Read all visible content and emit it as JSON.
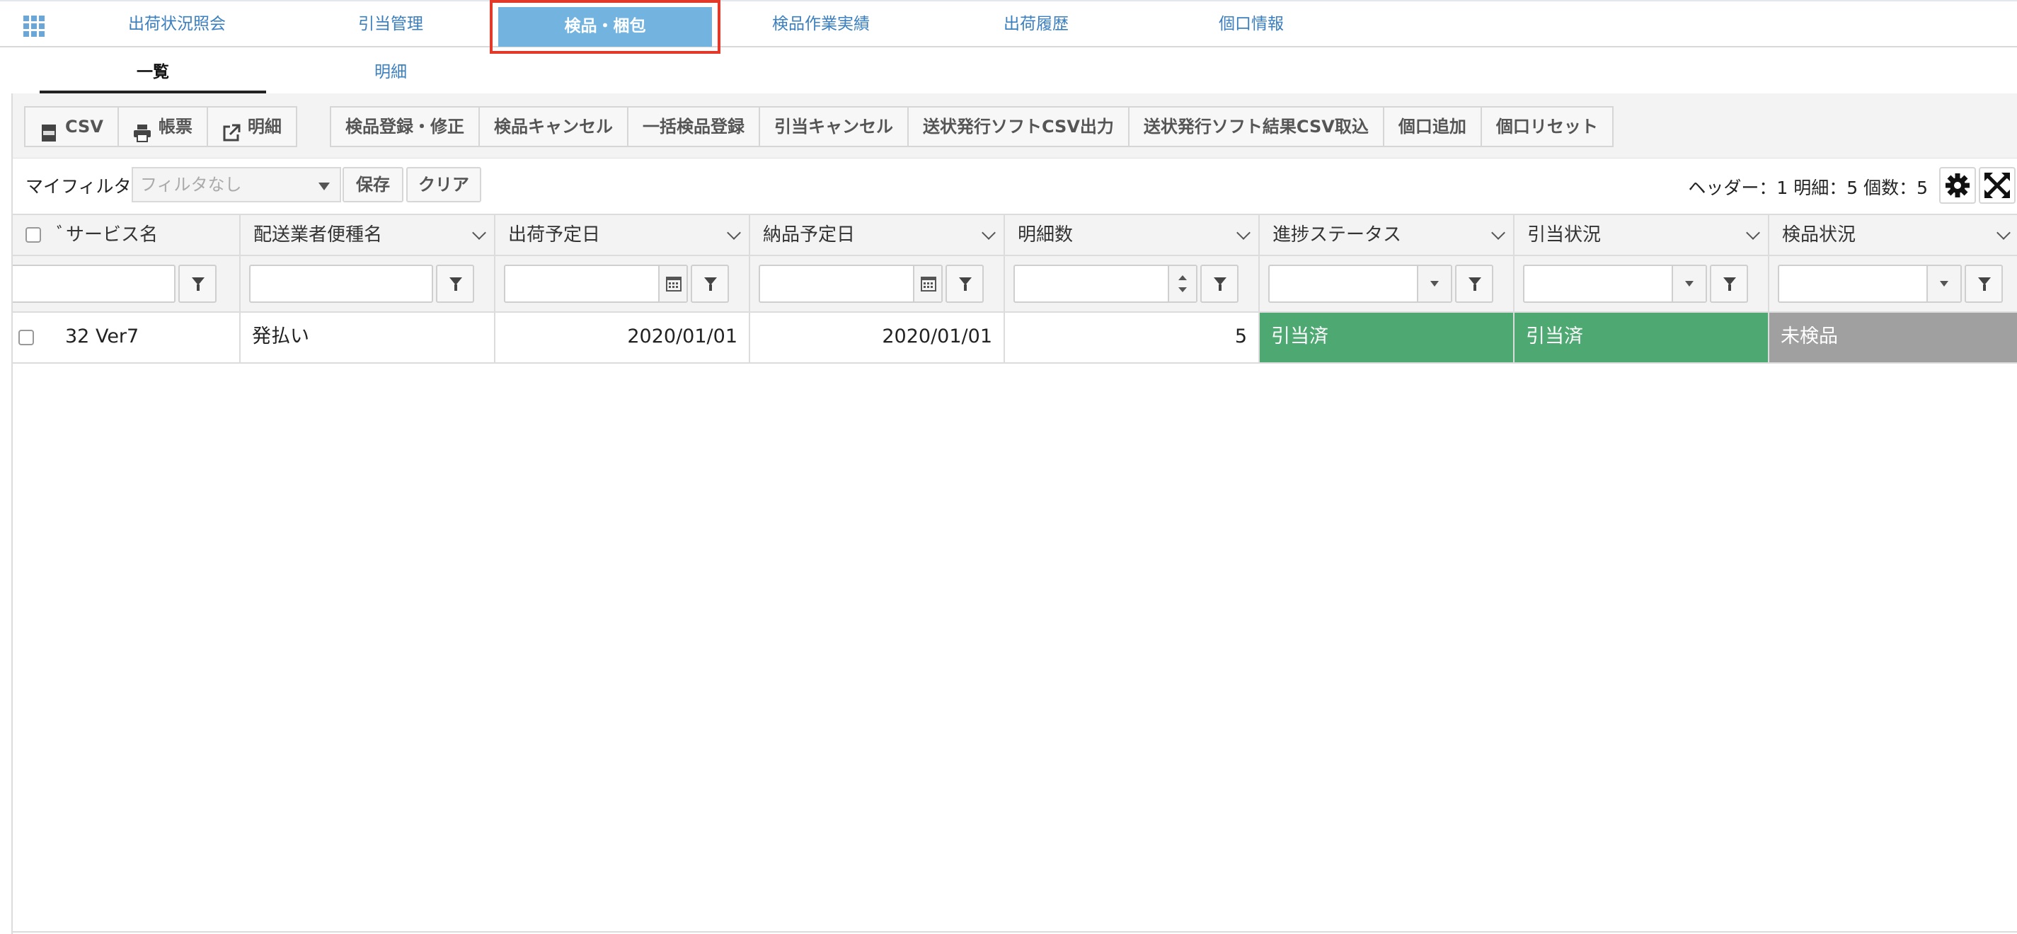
{
  "topnav": {
    "tabs": [
      {
        "label": "出荷状況照会"
      },
      {
        "label": "引当管理"
      },
      {
        "label": "検品・梱包"
      },
      {
        "label": "検品作業実績"
      },
      {
        "label": "出荷履歴"
      },
      {
        "label": "個口情報"
      }
    ],
    "active_index": 2
  },
  "subtabs": [
    {
      "label": "一覧"
    },
    {
      "label": "明細"
    }
  ],
  "toolbar": {
    "group1": [
      {
        "label": "CSV",
        "icon": "csv-icon"
      },
      {
        "label": "帳票",
        "icon": "printer-icon"
      },
      {
        "label": "明細",
        "icon": "external-link-icon"
      }
    ],
    "group2": [
      {
        "label": "検品登録・修正"
      },
      {
        "label": "検品キャンセル"
      },
      {
        "label": "一括検品登録"
      },
      {
        "label": "引当キャンセル"
      },
      {
        "label": "送状発行ソフトCSV出力"
      },
      {
        "label": "送状発行ソフト結果CSV取込"
      },
      {
        "label": "個口追加"
      },
      {
        "label": "個口リセット"
      }
    ]
  },
  "filter": {
    "label": "マイフィルタ",
    "select_value": "フィルタなし",
    "save_label": "保存",
    "clear_label": "クリア",
    "counts": "ヘッダー：1 明細：5 個数：5"
  },
  "grid": {
    "columns": [
      {
        "label": "サービス名",
        "prefix": "ﾞ"
      },
      {
        "label": "配送業者便種名"
      },
      {
        "label": "出荷予定日"
      },
      {
        "label": "納品予定日"
      },
      {
        "label": "明細数"
      },
      {
        "label": "進捗ステータス"
      },
      {
        "label": "引当状況"
      },
      {
        "label": "検品状況"
      }
    ],
    "rows": [
      {
        "service": "32 Ver7",
        "carrier": "発払い",
        "ship_date": "2020/01/01",
        "delivery_date": "2020/01/01",
        "line_count": "5",
        "progress": "引当済",
        "allocation": "引当済",
        "inspection": "未検品"
      }
    ]
  },
  "colors": {
    "accent": "#72b4df",
    "link": "#3b7fbf",
    "status_done": "#4ea872",
    "status_pending": "#a0a0a0",
    "highlight": "#e2392b"
  }
}
